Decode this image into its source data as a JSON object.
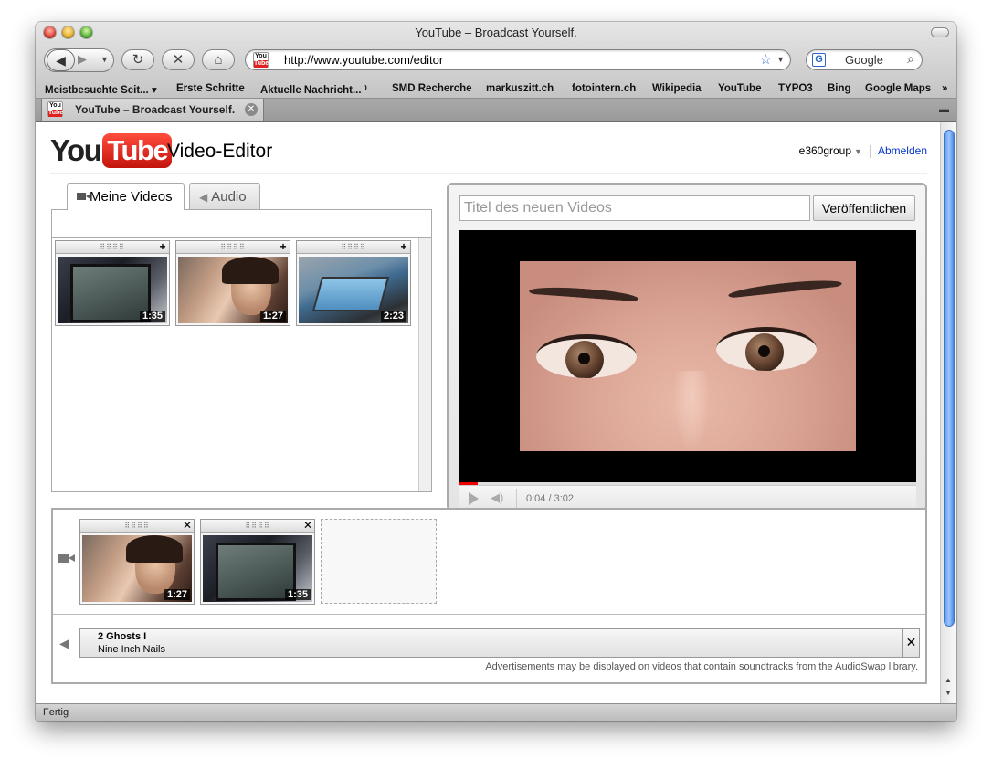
{
  "window": {
    "title": "YouTube – Broadcast Yourself."
  },
  "toolbar": {
    "url": "http://www.youtube.com/editor",
    "search_placeholder": "Google"
  },
  "bookmarks": [
    "Meistbesuchte Seit... ▾",
    "Erste Schritte",
    "Aktuelle Nachricht... ⁾",
    "SMD Recherche",
    "markuszitt.ch",
    "fotointern.ch",
    "Wikipedia",
    "YouTube",
    "TYPO3",
    "Bing",
    "Google Maps",
    "»"
  ],
  "tab": {
    "title": "YouTube – Broadcast Yourself."
  },
  "status": "Fertig",
  "page": {
    "logo_you": "You",
    "logo_tube": "Tube",
    "title": "Video-Editor",
    "user": "e360group",
    "logout": "Abmelden"
  },
  "left_tabs": {
    "videos": "Meine Videos",
    "audio": "Audio"
  },
  "my_videos": [
    {
      "duration": "1:35",
      "kind": "camera"
    },
    {
      "duration": "1:27",
      "kind": "girl"
    },
    {
      "duration": "2:23",
      "kind": "machine"
    }
  ],
  "player": {
    "title_placeholder": "Titel des neuen Videos",
    "publish": "Veröffentlichen",
    "time": "0:04 / 3:02",
    "progress": 0.04
  },
  "timeline": {
    "clips": [
      {
        "duration": "1:27",
        "kind": "girl"
      },
      {
        "duration": "1:35",
        "kind": "camera"
      }
    ],
    "audio": {
      "title": "2 Ghosts I",
      "artist": "Nine Inch Nails"
    },
    "note": "Advertisements may be displayed on videos that contain soundtracks from the AudioSwap library."
  }
}
